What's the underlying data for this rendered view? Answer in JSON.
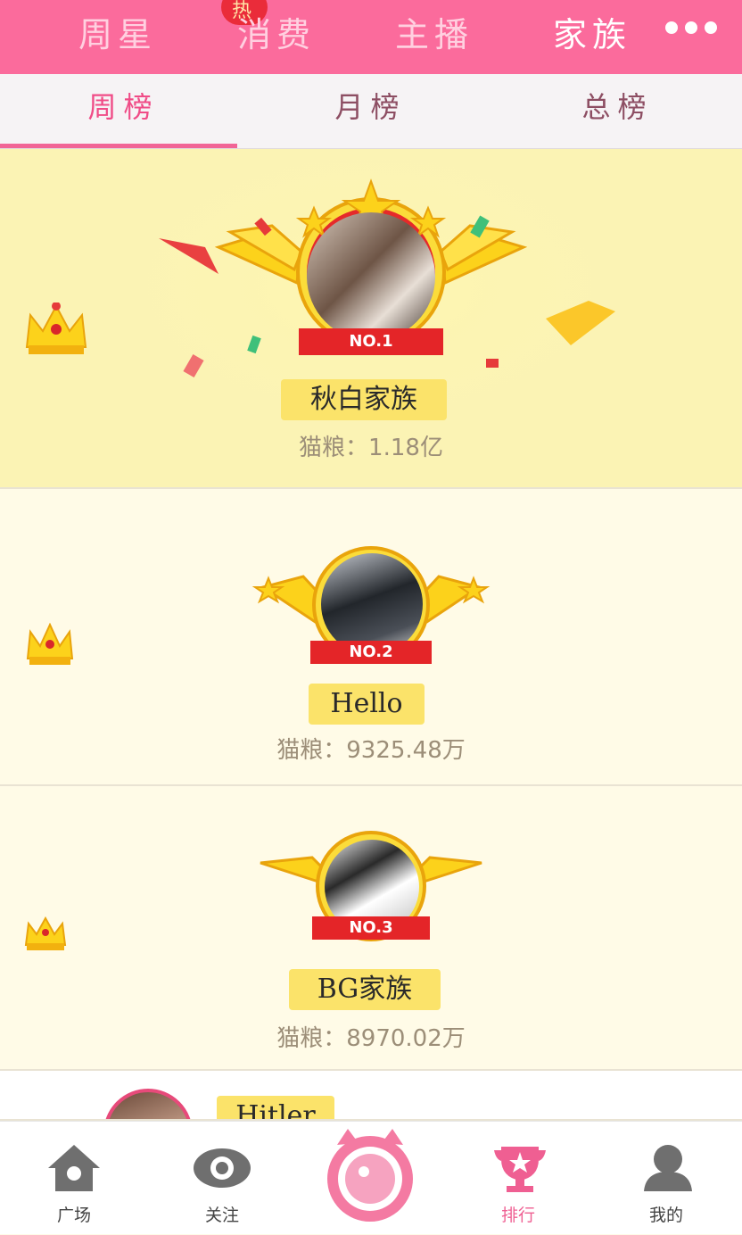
{
  "top_tabs": [
    {
      "label": "周星"
    },
    {
      "label": "消费"
    },
    {
      "label": "主播"
    },
    {
      "label": "家族"
    }
  ],
  "hot_badge": "热",
  "sub_tabs": [
    {
      "label": "周榜"
    },
    {
      "label": "月榜"
    },
    {
      "label": "总榜"
    }
  ],
  "ranks": [
    {
      "rank_label": "NO.1",
      "name": "秋白家族",
      "score": "猫粮：1.18亿"
    },
    {
      "rank_label": "NO.2",
      "name": "Hello",
      "score": "猫粮：9325.48万"
    },
    {
      "rank_label": "NO.3",
      "name": "BG家族",
      "score": "猫粮：8970.02万"
    },
    {
      "name": "Hitler"
    }
  ],
  "bottom_nav": [
    {
      "label": "广场",
      "icon": "home-icon"
    },
    {
      "label": "关注",
      "icon": "eye-icon"
    },
    {
      "label": "",
      "icon": "camera-cat-icon"
    },
    {
      "label": "排行",
      "icon": "trophy-icon"
    },
    {
      "label": "我的",
      "icon": "user-icon"
    }
  ],
  "colors": {
    "primary": "#fb6b9c",
    "active_text": "#f04c87",
    "ribbon": "#e42528",
    "namebox": "#fbe36a"
  }
}
